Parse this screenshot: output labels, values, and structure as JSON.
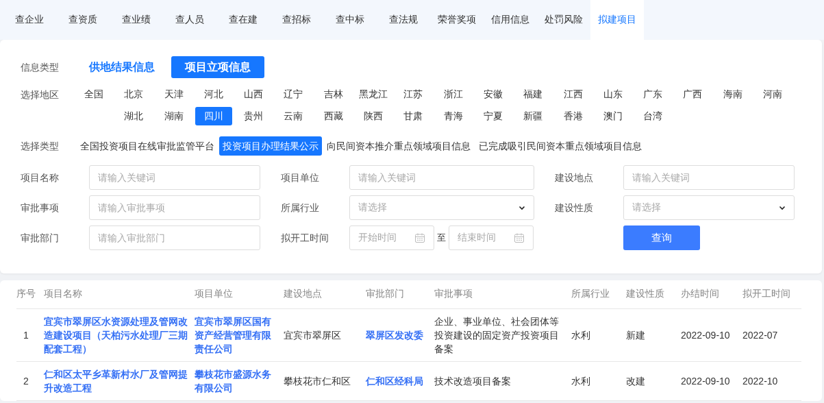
{
  "nav": [
    {
      "label": "查企业",
      "selected": false
    },
    {
      "label": "查资质",
      "selected": false
    },
    {
      "label": "查业绩",
      "selected": false
    },
    {
      "label": "查人员",
      "selected": false
    },
    {
      "label": "查在建",
      "selected": false
    },
    {
      "label": "查招标",
      "selected": false
    },
    {
      "label": "查中标",
      "selected": false
    },
    {
      "label": "查法规",
      "selected": false
    },
    {
      "label": "荣誉奖项",
      "selected": false
    },
    {
      "label": "信用信息",
      "selected": false
    },
    {
      "label": "处罚风险",
      "selected": false
    },
    {
      "label": "拟建项目",
      "selected": true
    }
  ],
  "info_type": {
    "label": "信息类型",
    "options": [
      {
        "label": "供地结果信息",
        "selected": false
      },
      {
        "label": "项目立项信息",
        "selected": true
      }
    ]
  },
  "region": {
    "label": "选择地区",
    "options": [
      {
        "label": "全国",
        "selected": false
      },
      {
        "label": "北京",
        "selected": false
      },
      {
        "label": "天津",
        "selected": false
      },
      {
        "label": "河北",
        "selected": false
      },
      {
        "label": "山西",
        "selected": false
      },
      {
        "label": "辽宁",
        "selected": false
      },
      {
        "label": "吉林",
        "selected": false
      },
      {
        "label": "黑龙江",
        "selected": false
      },
      {
        "label": "江苏",
        "selected": false
      },
      {
        "label": "浙江",
        "selected": false
      },
      {
        "label": "安徽",
        "selected": false
      },
      {
        "label": "福建",
        "selected": false
      },
      {
        "label": "江西",
        "selected": false
      },
      {
        "label": "山东",
        "selected": false
      },
      {
        "label": "广东",
        "selected": false
      },
      {
        "label": "广西",
        "selected": false
      },
      {
        "label": "海南",
        "selected": false
      },
      {
        "label": "河南",
        "selected": false
      },
      {
        "label": "湖北",
        "selected": false
      },
      {
        "label": "湖南",
        "selected": false
      },
      {
        "label": "四川",
        "selected": true
      },
      {
        "label": "贵州",
        "selected": false
      },
      {
        "label": "云南",
        "selected": false
      },
      {
        "label": "西藏",
        "selected": false
      },
      {
        "label": "陕西",
        "selected": false
      },
      {
        "label": "甘肃",
        "selected": false
      },
      {
        "label": "青海",
        "selected": false
      },
      {
        "label": "宁夏",
        "selected": false
      },
      {
        "label": "新疆",
        "selected": false
      },
      {
        "label": "香港",
        "selected": false
      },
      {
        "label": "澳门",
        "selected": false
      },
      {
        "label": "台湾",
        "selected": false
      }
    ]
  },
  "source_type": {
    "label": "选择类型",
    "options": [
      {
        "label": "全国投资项目在线审批监管平台",
        "selected": false
      },
      {
        "label": "投资项目办理结果公示",
        "selected": true
      },
      {
        "label": "向民间资本推介重点领域项目信息",
        "selected": false
      },
      {
        "label": "已完成吸引民间资本重点领域项目信息",
        "selected": false
      }
    ]
  },
  "filters": [
    {
      "kind": "text",
      "label": "项目名称",
      "placeholder": "请输入关键词"
    },
    {
      "kind": "text",
      "label": "项目单位",
      "placeholder": "请输入关键词"
    },
    {
      "kind": "text",
      "label": "建设地点",
      "placeholder": "请输入关键词"
    },
    {
      "kind": "text",
      "label": "审批事项",
      "placeholder": "请输入审批事项"
    },
    {
      "kind": "select",
      "label": "所属行业",
      "placeholder": "请选择"
    },
    {
      "kind": "select",
      "label": "建设性质",
      "placeholder": "请选择"
    },
    {
      "kind": "text",
      "label": "审批部门",
      "placeholder": "请输入审批部门"
    },
    {
      "kind": "daterange",
      "label": "拟开工时间",
      "start_placeholder": "开始时间",
      "separator": "至",
      "end_placeholder": "结束时间"
    },
    {
      "kind": "button",
      "label": "查询"
    }
  ],
  "table": {
    "columns": [
      {
        "label": "序号",
        "kind": "text"
      },
      {
        "label": "项目名称",
        "kind": "link"
      },
      {
        "label": "项目单位",
        "kind": "link"
      },
      {
        "label": "建设地点",
        "kind": "text"
      },
      {
        "label": "审批部门",
        "kind": "link"
      },
      {
        "label": "审批事项",
        "kind": "text"
      },
      {
        "label": "所属行业",
        "kind": "text"
      },
      {
        "label": "建设性质",
        "kind": "text"
      },
      {
        "label": "办结时间",
        "kind": "text"
      },
      {
        "label": "拟开工时间",
        "kind": "text"
      }
    ],
    "rows": [
      [
        "1",
        "宜宾市翠屏区水资源处理及管网改造建设项目（天柏污水处理厂三期配套工程）",
        "宜宾市翠屏区国有资产经营管理有限责任公司",
        "宜宾市翠屏区",
        "翠屏区发改委",
        "企业、事业单位、社会团体等投资建设的固定资产投资项目备案",
        "水利",
        "新建",
        "2022-09-10",
        "2022-07"
      ],
      [
        "2",
        "仁和区太平乡革新村水厂及管网提升改造工程",
        "攀枝花市盛源水务有限公司",
        "攀枝花市仁和区",
        "仁和区经科局",
        "技术改造项目备案",
        "水利",
        "改建",
        "2022-09-10",
        "2022-10"
      ]
    ]
  }
}
